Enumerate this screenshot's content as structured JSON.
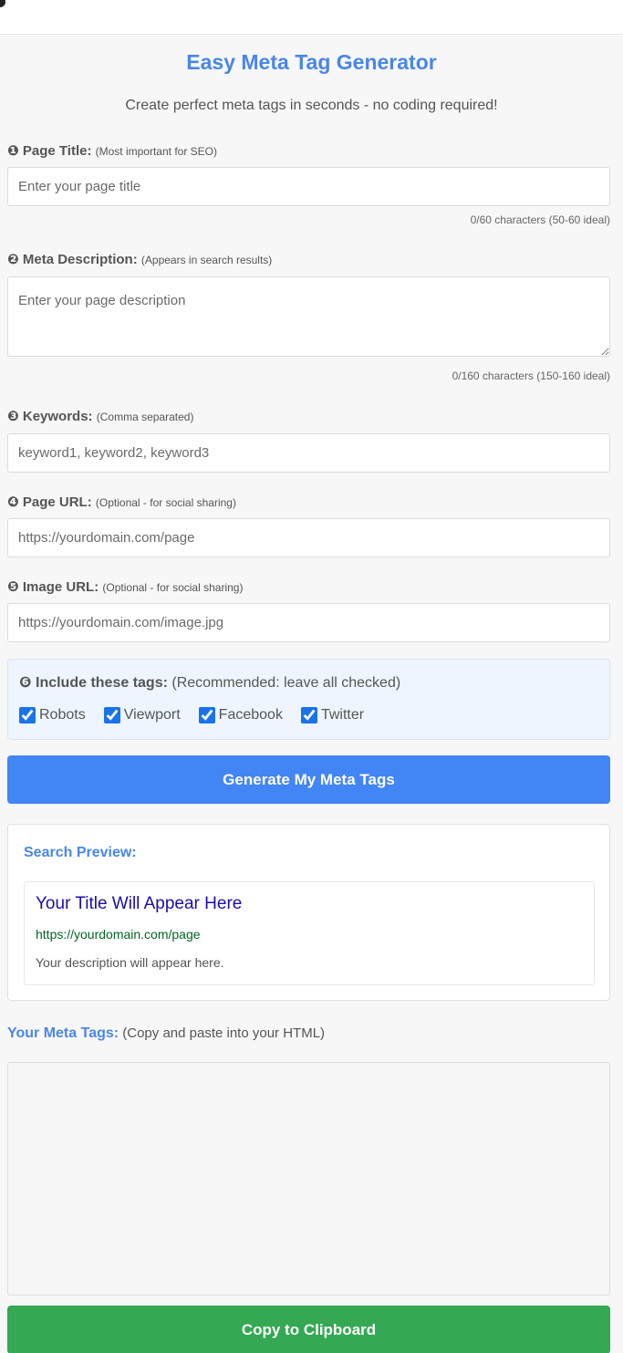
{
  "app": {
    "title": "Easy Meta Tag Generator",
    "subtitle": "Create perfect meta tags in seconds - no coding required!"
  },
  "fields": {
    "page_title": {
      "label": "❶ Page Title:",
      "hint": "(Most important for SEO)",
      "placeholder": "Enter your page title",
      "value": "",
      "counter": "0/60 characters (50-60 ideal)"
    },
    "meta_description": {
      "label": "❷ Meta Description:",
      "hint": "(Appears in search results)",
      "placeholder": "Enter your page description",
      "value": "",
      "counter": "0/160 characters (150-160 ideal)"
    },
    "keywords": {
      "label": "❸ Keywords:",
      "hint": "(Comma separated)",
      "placeholder": "keyword1, keyword2, keyword3",
      "value": ""
    },
    "page_url": {
      "label": "❹ Page URL:",
      "hint": "(Optional - for social sharing)",
      "placeholder": "https://yourdomain.com/page",
      "value": ""
    },
    "image_url": {
      "label": "❺ Image URL:",
      "hint": "(Optional - for social sharing)",
      "placeholder": "https://yourdomain.com/image.jpg",
      "value": ""
    }
  },
  "include_tags": {
    "label": "❻ Include these tags:",
    "hint": "(Recommended: leave all checked)",
    "options": [
      {
        "label": "Robots",
        "checked": true
      },
      {
        "label": "Viewport",
        "checked": true
      },
      {
        "label": "Facebook",
        "checked": true
      },
      {
        "label": "Twitter",
        "checked": true
      }
    ]
  },
  "buttons": {
    "generate": "Generate My Meta Tags",
    "copy": "Copy to Clipboard"
  },
  "preview": {
    "heading": "Search Preview:",
    "title": "Your Title Will Appear Here",
    "url": "https://yourdomain.com/page",
    "description": "Your description will appear here."
  },
  "output": {
    "label": "Your Meta Tags:",
    "hint": "(Copy and paste into your HTML)",
    "value": ""
  },
  "colors": {
    "accent": "#4a86e8",
    "generate_button": "#4285f4",
    "copy_button": "#34a853",
    "serp_title": "#1a0dab",
    "serp_url": "#006621"
  }
}
